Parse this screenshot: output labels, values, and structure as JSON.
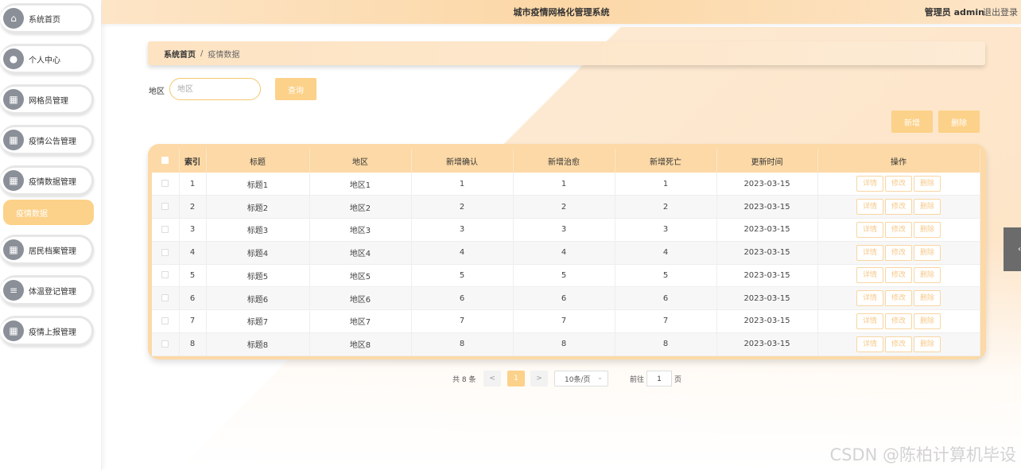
{
  "header": {
    "title": "城市疫情网格化管理系统",
    "user": "管理员 admin",
    "logout": "退出登录"
  },
  "sidebar": {
    "items": [
      {
        "label": "系统首页",
        "icon": "home-icon"
      },
      {
        "label": "个人中心",
        "icon": "user-icon"
      },
      {
        "label": "网格员管理",
        "icon": "grid-icon"
      },
      {
        "label": "疫情公告管理",
        "icon": "grid-icon"
      },
      {
        "label": "疫情数据管理",
        "icon": "grid-icon"
      },
      {
        "label": "居民档案管理",
        "icon": "grid-icon"
      },
      {
        "label": "体温登记管理",
        "icon": "list-icon"
      },
      {
        "label": "疫情上报管理",
        "icon": "grid-icon"
      }
    ],
    "sub_item": "疫情数据"
  },
  "breadcrumb": {
    "home": "系统首页",
    "separator": "/",
    "current": "疫情数据"
  },
  "search": {
    "label": "地区",
    "placeholder": "地区",
    "button": "查询"
  },
  "actions": {
    "add": "新增",
    "delete": "删除"
  },
  "table": {
    "columns": [
      "索引",
      "标题",
      "地区",
      "新增确认",
      "新增治愈",
      "新增死亡",
      "更新时间",
      "操作"
    ],
    "rows": [
      [
        "1",
        "标题1",
        "地区1",
        "1",
        "1",
        "1",
        "2023-03-15"
      ],
      [
        "2",
        "标题2",
        "地区2",
        "2",
        "2",
        "2",
        "2023-03-15"
      ],
      [
        "3",
        "标题3",
        "地区3",
        "3",
        "3",
        "3",
        "2023-03-15"
      ],
      [
        "4",
        "标题4",
        "地区4",
        "4",
        "4",
        "4",
        "2023-03-15"
      ],
      [
        "5",
        "标题5",
        "地区5",
        "5",
        "5",
        "5",
        "2023-03-15"
      ],
      [
        "6",
        "标题6",
        "地区6",
        "6",
        "6",
        "6",
        "2023-03-15"
      ],
      [
        "7",
        "标题7",
        "地区7",
        "7",
        "7",
        "7",
        "2023-03-15"
      ],
      [
        "8",
        "标题8",
        "地区8",
        "8",
        "8",
        "8",
        "2023-03-15"
      ]
    ],
    "row_actions": [
      "详情",
      "修改",
      "删除"
    ]
  },
  "pagination": {
    "total": "共 8 条",
    "prev": "<",
    "current": "1",
    "next": ">",
    "page_size": "10条/页",
    "goto_label": "前往",
    "goto_value": "1",
    "page_label": "页"
  },
  "watermark": "CSDN @陈柏计算机毕设",
  "colors": {
    "accent": "#fcd189",
    "header_bg": "#fcd7a6",
    "table_header": "#fcd9a6"
  }
}
